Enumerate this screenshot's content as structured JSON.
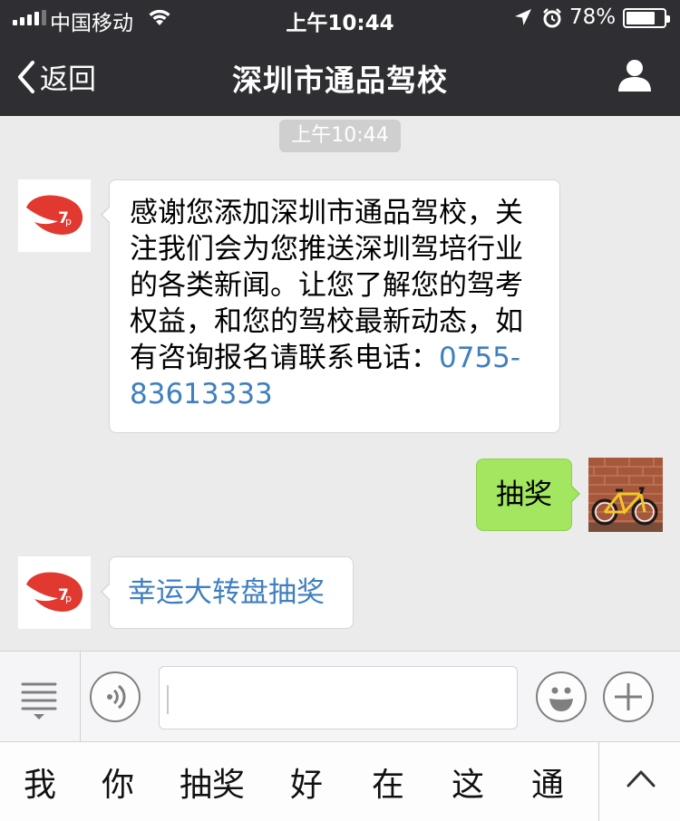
{
  "status_bar": {
    "carrier": "中国移动",
    "time": "上午10:44",
    "battery": "78%",
    "battery_level": 0.78,
    "icons": [
      "signal-icon",
      "wifi-icon",
      "location-arrow-icon",
      "alarm-icon",
      "battery-icon"
    ]
  },
  "nav": {
    "back_label": "返回",
    "title": "深圳市通品驾校",
    "icons": [
      "chevron-left-icon",
      "person-icon"
    ]
  },
  "chat": {
    "timestamp": "上午10:44",
    "messages": [
      {
        "from": "account",
        "avatar": "driving-school-logo",
        "text": "感谢您添加深圳市通品驾校，关注我们会为您推送深圳驾培行业的各类新闻。让您了解您的驾考权益，和您的驾校最新动态，如有咨询报名请联系电话：",
        "link": "0755-83613333"
      },
      {
        "from": "user",
        "avatar": "bicycle-photo",
        "text": "抽奖"
      },
      {
        "from": "account",
        "avatar": "driving-school-logo",
        "link": "幸运大转盘抽奖"
      }
    ]
  },
  "input_bar": {
    "value": "",
    "icons": [
      "menu-list-icon",
      "voice-icon",
      "emoji-icon",
      "plus-icon"
    ]
  },
  "keyboard_suggestions": {
    "words": [
      "我",
      "你",
      "抽奖",
      "好",
      "在",
      "这",
      "通"
    ],
    "icon": "chevron-up-icon"
  },
  "colors": {
    "nav_background": "#2f2f33",
    "chat_background": "#ebebeb",
    "sent_bubble": "#a2e75f",
    "link": "#3f7fbf",
    "logo_red": "#e1392f"
  }
}
